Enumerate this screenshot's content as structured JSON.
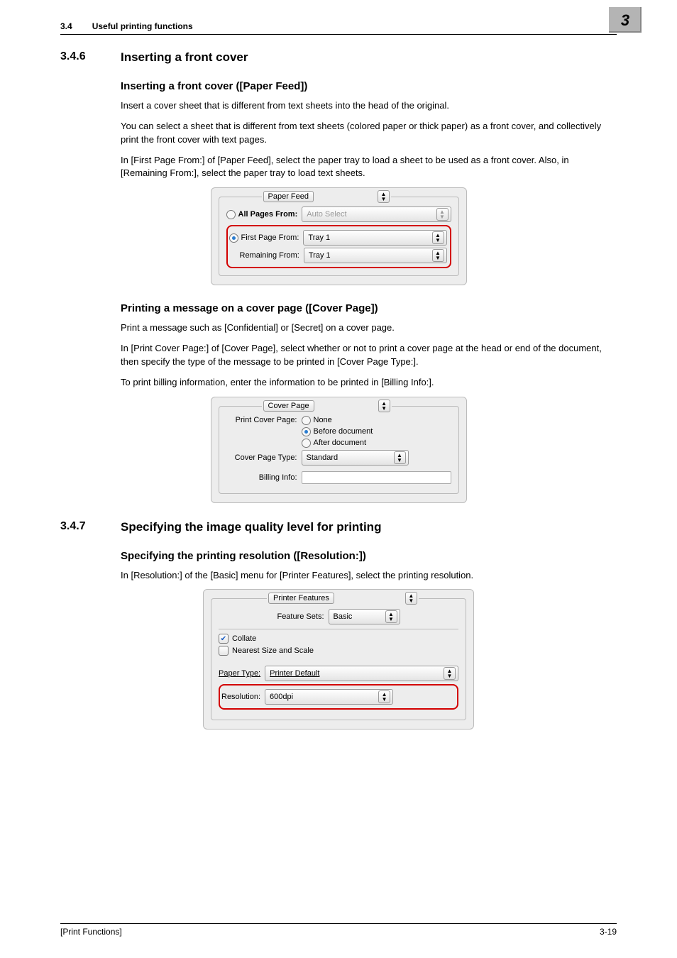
{
  "header": {
    "section_no": "3.4",
    "section_title": "Useful printing functions",
    "chapter_badge": "3"
  },
  "s346": {
    "number": "3.4.6",
    "title": "Inserting a front cover",
    "blockA": {
      "subhead": "Inserting a front cover ([Paper Feed])",
      "p1": "Insert a cover sheet that is different from text sheets into the head of the original.",
      "p2": "You can select a sheet that is different from text sheets (colored paper or thick paper) as a front cover, and collectively print the front cover with text pages.",
      "p3": "In [First Page From:] of [Paper Feed], select the paper tray to load a sheet to be used as a front cover. Also, in [Remaining From:], select the paper tray to load text sheets."
    },
    "fig1": {
      "legend": "Paper Feed",
      "rows": {
        "all_pages_label": "All Pages From:",
        "all_pages_value": "Auto Select",
        "first_page_label": "First Page From:",
        "first_page_value": "Tray 1",
        "remaining_label": "Remaining From:",
        "remaining_value": "Tray 1"
      }
    },
    "blockB": {
      "subhead": "Printing a message on a cover page ([Cover Page])",
      "p1": "Print a message such as [Confidential] or [Secret] on a cover page.",
      "p2": "In [Print Cover Page:] of [Cover Page], select whether or not to print a cover page at the head or end of the document, then specify the type of the message to be printed in [Cover Page Type:].",
      "p3": "To print billing information, enter the information to be printed in [Billing Info:]."
    },
    "fig2": {
      "legend": "Cover Page",
      "print_cover_label": "Print Cover Page:",
      "opt_none": "None",
      "opt_before": "Before document",
      "opt_after": "After document",
      "cover_type_label": "Cover Page Type:",
      "cover_type_value": "Standard",
      "billing_label": "Billing Info:"
    }
  },
  "s347": {
    "number": "3.4.7",
    "title": "Specifying the image quality level for printing",
    "blockA": {
      "subhead": "Specifying the printing resolution ([Resolution:])",
      "p1": "In [Resolution:] of the [Basic] menu for [Printer Features], select the printing resolution."
    },
    "fig3": {
      "legend": "Printer Features",
      "feature_sets_label": "Feature Sets:",
      "feature_sets_value": "Basic",
      "collate": "Collate",
      "nearest": "Nearest Size and Scale",
      "paper_type_label": "Paper Type:",
      "paper_type_value": "Printer Default",
      "resolution_label": "Resolution:",
      "resolution_value": "600dpi"
    }
  },
  "footer": {
    "left": "[Print Functions]",
    "right": "3-19"
  }
}
